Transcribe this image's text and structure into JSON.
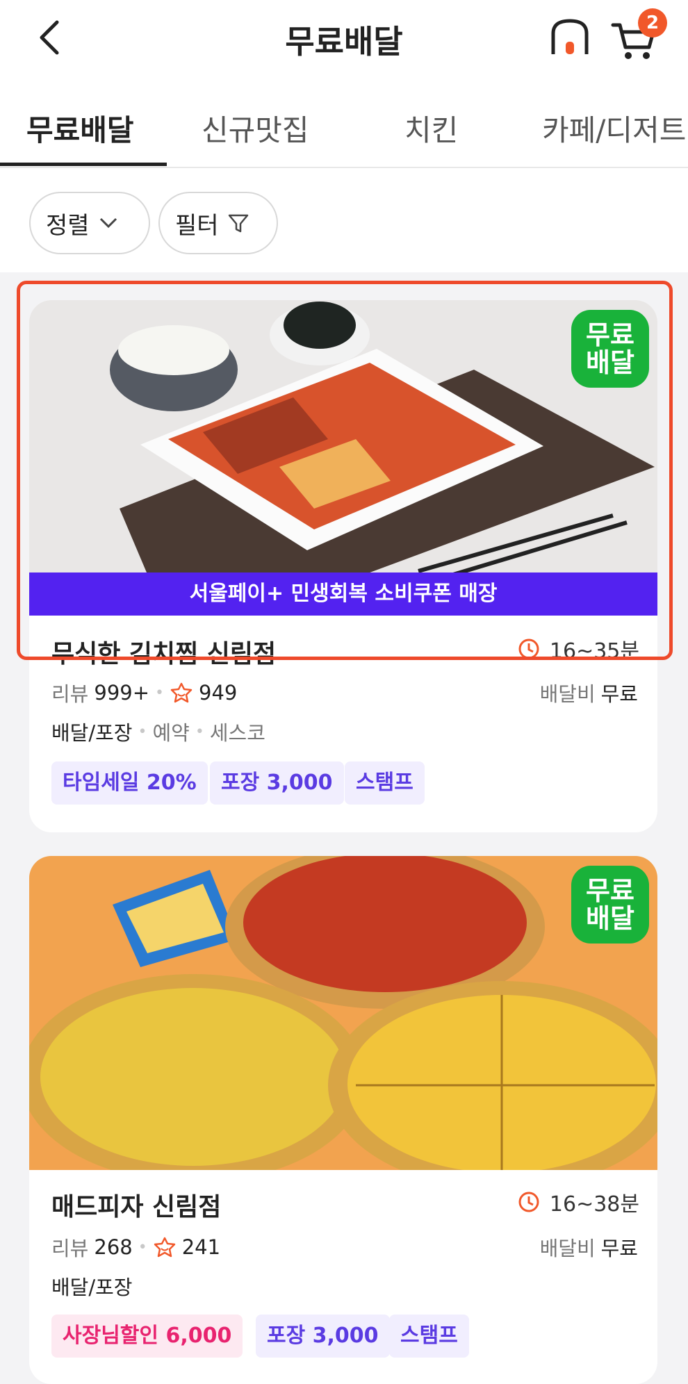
{
  "header": {
    "title": "무료배달",
    "cart_count": "2"
  },
  "tabs": [
    "무료배달",
    "신규맛집",
    "치킨",
    "카페/디저트"
  ],
  "filters": {
    "sort_label": "정렬",
    "filter_label": "필터"
  },
  "stores": [
    {
      "free_badge": [
        "무료",
        "배달"
      ],
      "banner": "서울페이+ 민생회복 소비쿠폰 매장",
      "name": "무식한 김치찜 신림점",
      "eta": "16~35분",
      "reviews_label": "리뷰",
      "reviews": "999+",
      "rating": "949",
      "delivery_fee_label": "배달비",
      "delivery_fee": "무료",
      "services": [
        "배달/포장",
        "예약",
        "세스코"
      ],
      "tags": [
        "타임세일 20%",
        "포장 3,000",
        "스탬프"
      ]
    },
    {
      "free_badge": [
        "무료",
        "배달"
      ],
      "name": "매드피자 신림점",
      "eta": "16~38분",
      "reviews_label": "리뷰",
      "reviews": "268",
      "rating": "241",
      "delivery_fee_label": "배달비",
      "delivery_fee": "무료",
      "services": [
        "배달/포장"
      ],
      "tags": [
        "사장님할인 6,000",
        "포장 3,000",
        "스탬프"
      ]
    }
  ],
  "colors": {
    "accent": "#f1582a",
    "free_badge": "#19b23a",
    "banner": "#5322f0",
    "highlight": "#ee4a2b"
  }
}
